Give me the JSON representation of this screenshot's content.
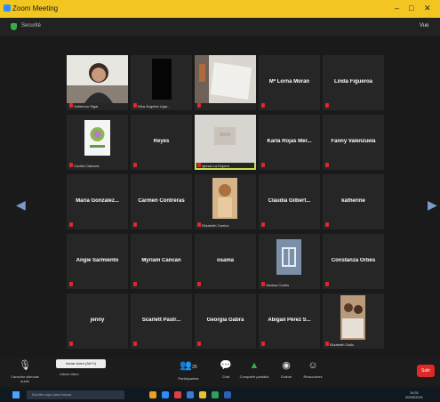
{
  "window": {
    "title": "Zoom Meeting"
  },
  "topbar": {
    "left_label": "Securité",
    "view_label": "Vue"
  },
  "grid": {
    "tiles": [
      {
        "name": "",
        "label": "Guillermo Sigal",
        "kind": "video-woman"
      },
      {
        "name": "",
        "label": "Elba Ángeles Ugar...",
        "kind": "video-dark"
      },
      {
        "name": "",
        "label": "",
        "kind": "video-doc"
      },
      {
        "name": "Mª Lorna Moran",
        "label": "",
        "kind": "name"
      },
      {
        "name": "Linda Figueroa",
        "label": "",
        "kind": "name"
      },
      {
        "name": "",
        "label": "Cecilia Ciabarra",
        "kind": "video-logo"
      },
      {
        "name": "Reyes",
        "label": "",
        "kind": "name"
      },
      {
        "name": "",
        "label": "Iglesia La Espera",
        "kind": "video-room",
        "active": true
      },
      {
        "name": "Karla Rojas Mer...",
        "label": "",
        "kind": "name"
      },
      {
        "name": "Fanny Valenzuela",
        "label": "",
        "kind": "name"
      },
      {
        "name": "Maria Gonzalez...",
        "label": "",
        "kind": "name"
      },
      {
        "name": "Carmen Contreras",
        "label": "",
        "kind": "name"
      },
      {
        "name": "",
        "label": "Elizabeth Carrizo",
        "kind": "video-person"
      },
      {
        "name": "Claudia Gilbert...",
        "label": "",
        "kind": "name"
      },
      {
        "name": "katherine",
        "label": "",
        "kind": "name"
      },
      {
        "name": "Angie Sarmiento",
        "label": "",
        "kind": "name"
      },
      {
        "name": "Myriam Cancan",
        "label": "",
        "kind": "name"
      },
      {
        "name": "osama",
        "label": "",
        "kind": "name"
      },
      {
        "name": "",
        "label": "Vanesa Cortes",
        "kind": "video-door"
      },
      {
        "name": "Constanza Orbes",
        "label": "",
        "kind": "name"
      },
      {
        "name": "jenny",
        "label": "",
        "kind": "name"
      },
      {
        "name": "Scarlett Pastr...",
        "label": "",
        "kind": "name"
      },
      {
        "name": "Georgia Gabra",
        "label": "",
        "kind": "name"
      },
      {
        "name": "Abigail Pérez S...",
        "label": "",
        "kind": "name"
      },
      {
        "name": "",
        "label": "Elizabeth Gallo",
        "kind": "video-family"
      }
    ]
  },
  "toolbar": {
    "tooltip": "Iniciar video (Alt+V)",
    "mute_label": "Cancelar silenciar audio",
    "video_label": "Iniciar video",
    "participants_label": "Participantes",
    "participants_count": "25",
    "chat_label": "Chat",
    "share_label": "Compartir pantalla",
    "record_label": "Grabar",
    "reactions_label": "Reacciones",
    "end_label": "Salir"
  },
  "taskbar": {
    "search_placeholder": "Escribe aquí para buscar",
    "time": "19:31",
    "date": "20/05/2021"
  },
  "colors": {
    "title_bar": "#f2c521",
    "active_speaker": "#c6e04b",
    "end_button": "#e02828",
    "share_button": "#2fb24c"
  }
}
